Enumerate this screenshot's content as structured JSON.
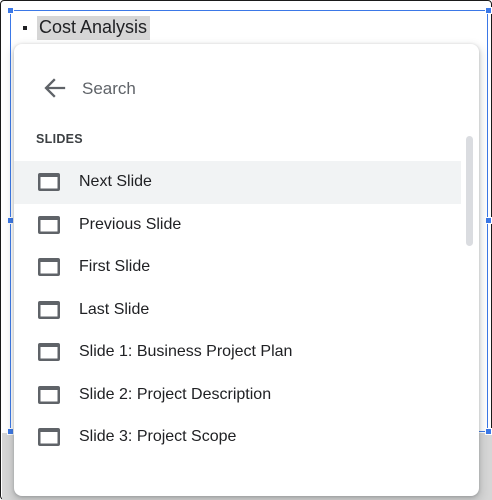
{
  "slide": {
    "selected_text": "Cost Analysis"
  },
  "search": {
    "placeholder": "Search",
    "back_icon": "arrow-left-icon"
  },
  "section": {
    "header": "SLIDES",
    "item_icon": "slide-icon",
    "items": [
      {
        "label": "Next Slide",
        "active": true
      },
      {
        "label": "Previous Slide",
        "active": false
      },
      {
        "label": "First Slide",
        "active": false
      },
      {
        "label": "Last Slide",
        "active": false
      },
      {
        "label": "Slide 1: Business Project Plan",
        "active": false
      },
      {
        "label": "Slide 2: Project Description",
        "active": false
      },
      {
        "label": "Slide 3: Project Scope",
        "active": false
      }
    ]
  },
  "colors": {
    "selection": "#3b78e7",
    "hover_row": "#f1f3f4",
    "icon": "#5f6368",
    "text": "#202124"
  }
}
